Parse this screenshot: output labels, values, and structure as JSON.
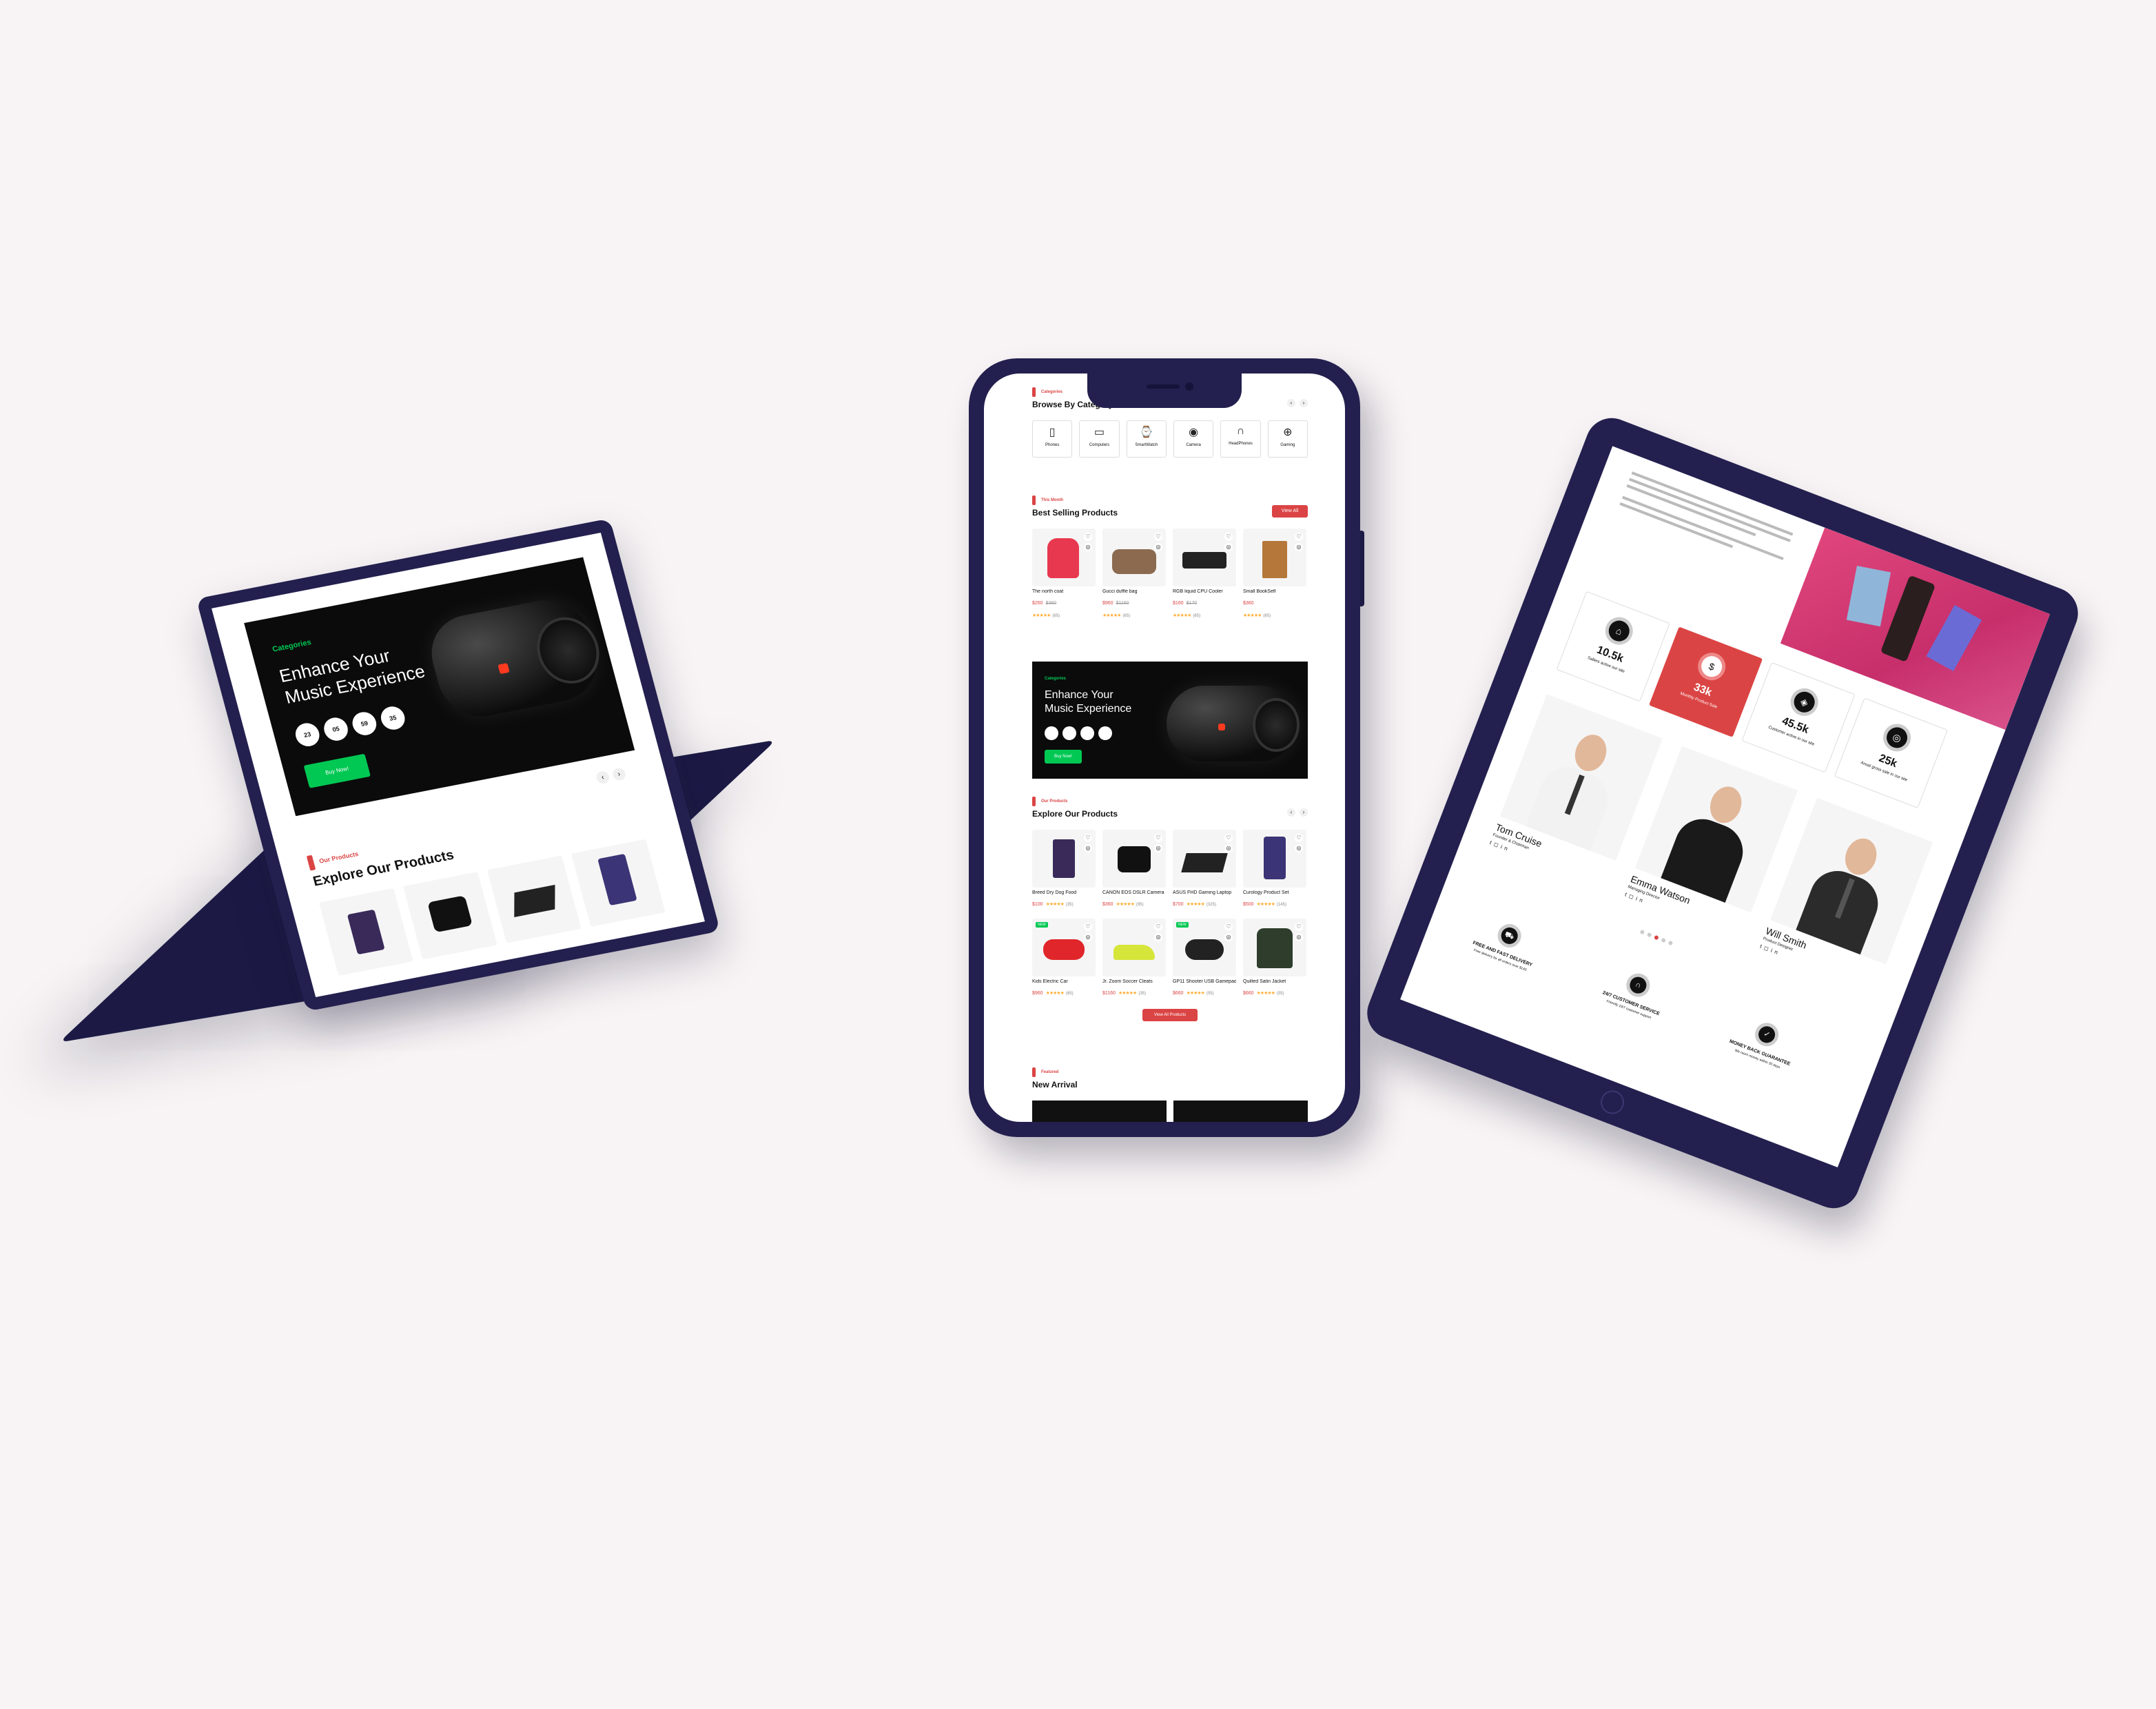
{
  "colors": {
    "background": "#f8f4f5",
    "device_frame": "#23204f",
    "accent_red": "#db4444",
    "accent_green": "#00c853",
    "banner_dark": "#111111"
  },
  "laptop": {
    "banner": {
      "tag": "Categories",
      "title": "Enhance Your Music Experience",
      "times": [
        "23",
        "05",
        "59",
        "35"
      ],
      "button": "Buy Now!"
    },
    "explore": {
      "tag": "Our Products",
      "title": "Explore Our Products"
    }
  },
  "phone": {
    "categories": {
      "tag": "Categories",
      "title": "Browse By Category",
      "items": [
        {
          "label": "Phones",
          "icon": "phone-icon"
        },
        {
          "label": "Computers",
          "icon": "computer-icon"
        },
        {
          "label": "SmartWatch",
          "icon": "smartwatch-icon"
        },
        {
          "label": "Camera",
          "icon": "camera-icon"
        },
        {
          "label": "HeadPhones",
          "icon": "headphones-icon"
        },
        {
          "label": "Gaming",
          "icon": "gamepad-icon"
        }
      ]
    },
    "best": {
      "tag": "This Month",
      "title": "Best Selling Products",
      "button": "View All",
      "products": [
        {
          "name": "The north coat",
          "price": "$260",
          "old": "$360",
          "reviews": "(65)",
          "color": "#e8384f",
          "shape": "coat"
        },
        {
          "name": "Gucci duffle bag",
          "price": "$960",
          "old": "$1160",
          "reviews": "(65)",
          "color": "#8b6a4f",
          "shape": "bag"
        },
        {
          "name": "RGB liquid CPU Cooler",
          "price": "$160",
          "old": "$170",
          "reviews": "(65)",
          "color": "#222",
          "shape": "cooler"
        },
        {
          "name": "Small BookSelf",
          "price": "$360",
          "old": "",
          "reviews": "(65)",
          "color": "#b5773a",
          "shape": "shelf"
        }
      ]
    },
    "banner": {
      "tag": "Categories",
      "title_line1": "Enhance Your",
      "title_line2": "Music Experience",
      "button": "Buy Now!"
    },
    "explore": {
      "tag": "Our Products",
      "title": "Explore Our Products",
      "button": "View All Products",
      "products": [
        {
          "name": "Breed Dry Dog Food",
          "price": "$100",
          "reviews": "(35)",
          "color": "#3a2a5a",
          "shape": "box",
          "badge": ""
        },
        {
          "name": "CANON EOS DSLR Camera",
          "price": "$360",
          "reviews": "(95)",
          "color": "#111",
          "shape": "camera",
          "badge": ""
        },
        {
          "name": "ASUS FHD Gaming Laptop",
          "price": "$700",
          "reviews": "(325)",
          "color": "#222",
          "shape": "laptop",
          "badge": ""
        },
        {
          "name": "Curology Product Set",
          "price": "$500",
          "reviews": "(145)",
          "color": "#3b3476",
          "shape": "bottles",
          "badge": ""
        },
        {
          "name": "Kids Electric Car",
          "price": "$960",
          "reviews": "(65)",
          "color": "#e0262b",
          "shape": "car",
          "badge": "NEW"
        },
        {
          "name": "Jr. Zoom Soccer Cleats",
          "price": "$1160",
          "reviews": "(35)",
          "color": "#d6e53a",
          "shape": "shoes",
          "badge": ""
        },
        {
          "name": "GP11 Shooter USB Gamepad",
          "price": "$660",
          "reviews": "(55)",
          "color": "#222",
          "shape": "gamepad",
          "badge": "NEW"
        },
        {
          "name": "Quilted Satin Jacket",
          "price": "$660",
          "reviews": "(55)",
          "color": "#2e3d2c",
          "shape": "jacket",
          "badge": ""
        }
      ]
    },
    "new_arrival": {
      "tag": "Featured",
      "title": "New Arrival"
    }
  },
  "tablet": {
    "stats": [
      {
        "value": "10.5k",
        "label": "Sallers active our site",
        "icon": "shop-icon",
        "highlight": false
      },
      {
        "value": "33k",
        "label": "Monthly Product Sale",
        "icon": "dollar-icon",
        "highlight": true
      },
      {
        "value": "45.5k",
        "label": "Customer active in our site",
        "icon": "bag-icon",
        "highlight": false
      },
      {
        "value": "25k",
        "label": "Anual gross sale in our site",
        "icon": "money-icon",
        "highlight": false
      }
    ],
    "team": [
      {
        "name": "Tom Cruise",
        "role": "Founder & Chairman",
        "suit": "#f2f2f2",
        "tie": "#333"
      },
      {
        "name": "Emma Watson",
        "role": "Managing Director",
        "suit": "#1a1a1a",
        "tie": "#1a1a1a"
      },
      {
        "name": "Will Smith",
        "role": "Product Designer",
        "suit": "#2b2b2b",
        "tie": "#555"
      }
    ],
    "services": [
      {
        "title": "FREE AND FAST DELIVERY",
        "desc": "Free delivery for all orders over $140",
        "icon": "truck-icon"
      },
      {
        "title": "24/7 CUSTOMER SERVICE",
        "desc": "Friendly 24/7 customer support",
        "icon": "headset-icon"
      },
      {
        "title": "MONEY BACK GUARANTEE",
        "desc": "We reurn money within 30 days",
        "icon": "shield-icon"
      }
    ]
  }
}
